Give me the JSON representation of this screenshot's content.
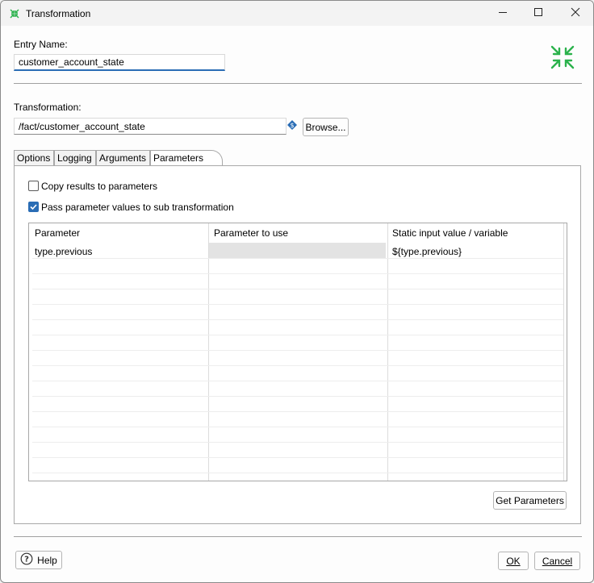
{
  "window": {
    "title": "Transformation",
    "icon": "transformation-icon",
    "controls": [
      "minimize-icon",
      "maximize-icon",
      "close-icon"
    ]
  },
  "entry": {
    "label": "Entry Name:",
    "value": "customer_account_state",
    "logo_icon": "collapse-arrows-icon",
    "accent_color": "#2bb24c"
  },
  "transformation": {
    "label": "Transformation:",
    "value": "/fact/customer_account_state",
    "variable_icon": "variable-diamond-icon",
    "browse_label": "Browse..."
  },
  "tabs": [
    {
      "label": "Options",
      "active": false
    },
    {
      "label": "Logging",
      "active": false
    },
    {
      "label": "Arguments",
      "active": false
    },
    {
      "label": "Parameters",
      "active": true
    }
  ],
  "parameters": {
    "copy_results": {
      "label": "Copy results to parameters",
      "checked": false
    },
    "pass_values": {
      "label": "Pass parameter values to sub transformation",
      "checked": true
    },
    "columns": [
      "Parameter",
      "Parameter to use",
      "Static input value / variable"
    ],
    "rows": [
      [
        "type.previous",
        "",
        "${type.previous}"
      ]
    ],
    "get_parameters_label": "Get Parameters"
  },
  "footer": {
    "help_label": "Help",
    "ok_label": "OK",
    "cancel_label": "Cancel"
  }
}
